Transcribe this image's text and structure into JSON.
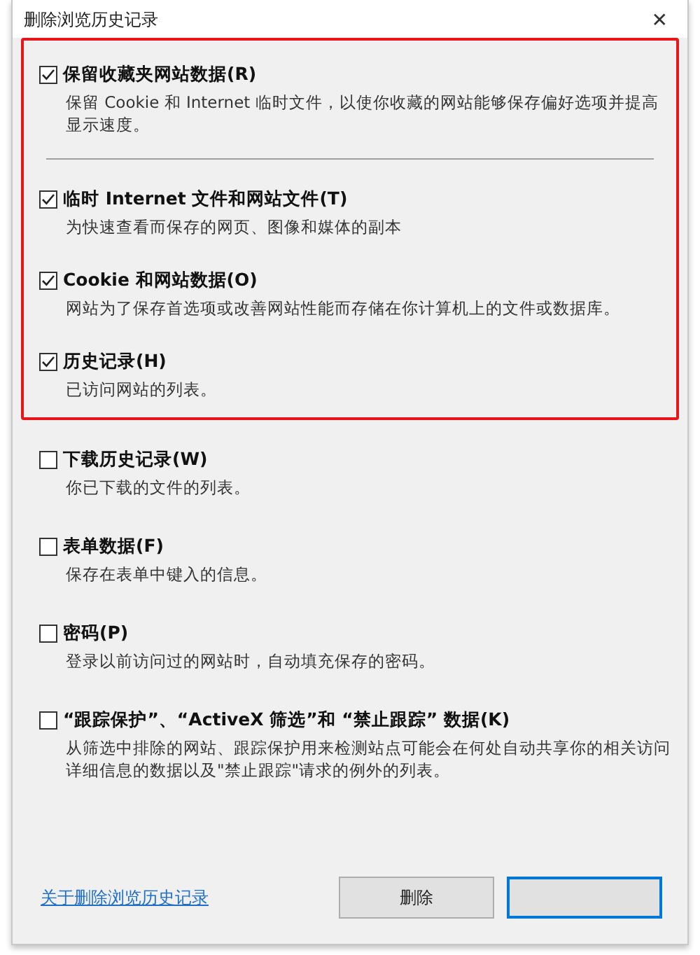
{
  "window": {
    "title": "删除浏览历史记录",
    "close": "✕"
  },
  "highlight_box": {
    "sections": [
      [
        {
          "label": "保留收藏夹网站数据(R)",
          "description": "保留 Cookie 和 Internet 临时文件，以使你收藏的网站能够保存偏好选项并提高显示速度。",
          "checked": true
        }
      ],
      [
        {
          "label": "临时 Internet 文件和网站文件(T)",
          "description": "为快速查看而保存的网页、图像和媒体的副本",
          "checked": true
        },
        {
          "label": "Cookie 和网站数据(O)",
          "description": "网站为了保存首选项或改善网站性能而存储在你计算机上的文件或数据库。",
          "checked": true
        },
        {
          "label": "历史记录(H)",
          "description": "已访问网站的列表。",
          "checked": true
        }
      ]
    ]
  },
  "options": [
    {
      "label": "下载历史记录(W)",
      "description": "你已下载的文件的列表。",
      "checked": false
    },
    {
      "label": "表单数据(F)",
      "description": "保存在表单中键入的信息。",
      "checked": false
    },
    {
      "label": "密码(P)",
      "description": "登录以前访问过的网站时，自动填充保存的密码。",
      "checked": false
    },
    {
      "label": "“跟踪保护”、“ActiveX 筛选”和 “禁止跟踪” 数据(K)",
      "description": "从筛选中排除的网站、跟踪保护用来检测站点可能会在何处自动共享你的相关访问详细信息的数据以及\"禁止跟踪\"请求的例外的列表。",
      "checked": false
    }
  ],
  "footer": {
    "link": "关于删除浏览历史记录",
    "buttons": [
      {
        "label": "删除",
        "focused": false
      },
      {
        "focused": true
      }
    ]
  }
}
